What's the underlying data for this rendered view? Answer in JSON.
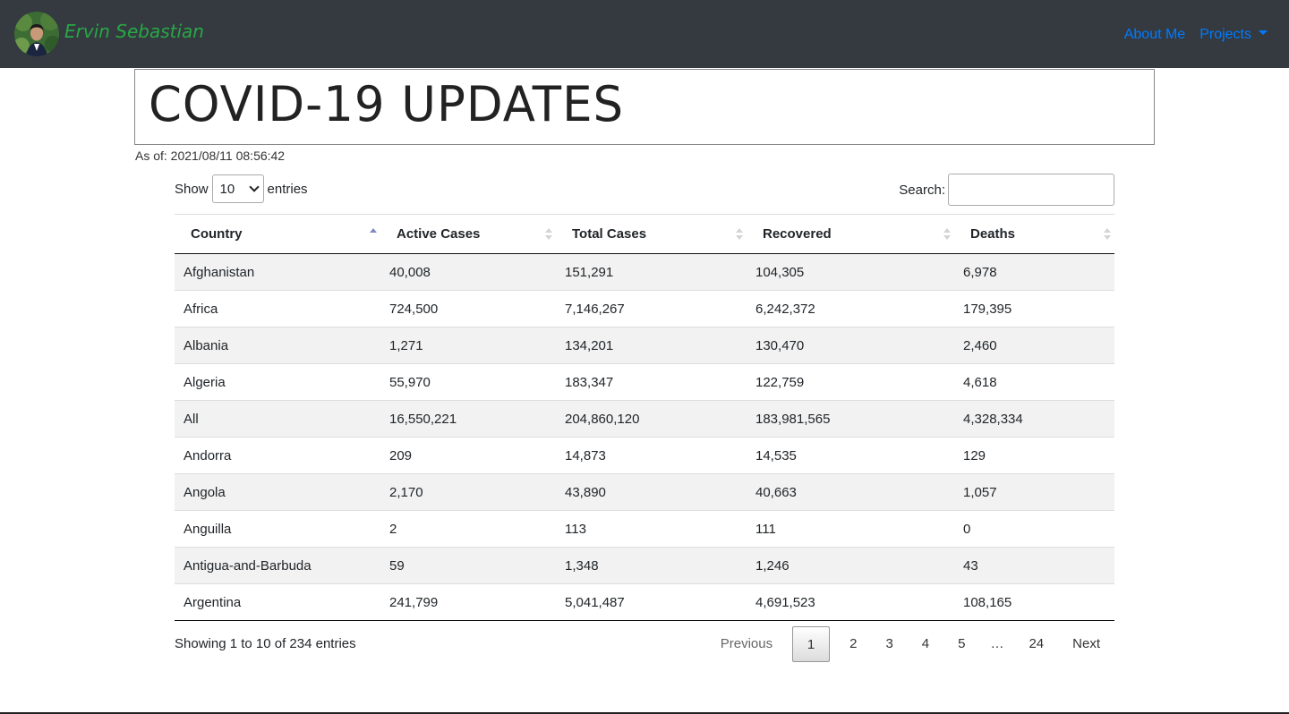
{
  "navbar": {
    "brand_name": "Ervin Sebastian",
    "links": [
      {
        "label": "About Me"
      },
      {
        "label": "Projects"
      }
    ],
    "colors": {
      "background": "#343a40",
      "brand": "#28a745",
      "link": "#007bff"
    }
  },
  "header": {
    "title": "COVID-19 UPDATES",
    "as_of": "As of: 2021/08/11 08:56:42"
  },
  "controls": {
    "show_label": "Show",
    "entries_label": "entries",
    "page_length_selected": "10",
    "search_label": "Search:",
    "search_value": ""
  },
  "table": {
    "columns": [
      "Country",
      "Active Cases",
      "Total Cases",
      "Recovered",
      "Deaths"
    ],
    "sorted_column": "Country",
    "sort_direction": "ascending",
    "rows": [
      [
        "Afghanistan",
        "40,008",
        "151,291",
        "104,305",
        "6,978"
      ],
      [
        "Africa",
        "724,500",
        "7,146,267",
        "6,242,372",
        "179,395"
      ],
      [
        "Albania",
        "1,271",
        "134,201",
        "130,470",
        "2,460"
      ],
      [
        "Algeria",
        "55,970",
        "183,347",
        "122,759",
        "4,618"
      ],
      [
        "All",
        "16,550,221",
        "204,860,120",
        "183,981,565",
        "4,328,334"
      ],
      [
        "Andorra",
        "209",
        "14,873",
        "14,535",
        "129"
      ],
      [
        "Angola",
        "2,170",
        "43,890",
        "40,663",
        "1,057"
      ],
      [
        "Anguilla",
        "2",
        "113",
        "111",
        "0"
      ],
      [
        "Antigua-and-Barbuda",
        "59",
        "1,348",
        "1,246",
        "43"
      ],
      [
        "Argentina",
        "241,799",
        "5,041,487",
        "4,691,523",
        "108,165"
      ]
    ]
  },
  "footer": {
    "info": "Showing 1 to 10 of 234 entries",
    "pagination": {
      "previous": "Previous",
      "pages": [
        "1",
        "2",
        "3",
        "4",
        "5"
      ],
      "ellipsis": "…",
      "last_page": "24",
      "next": "Next",
      "current": "1"
    }
  }
}
